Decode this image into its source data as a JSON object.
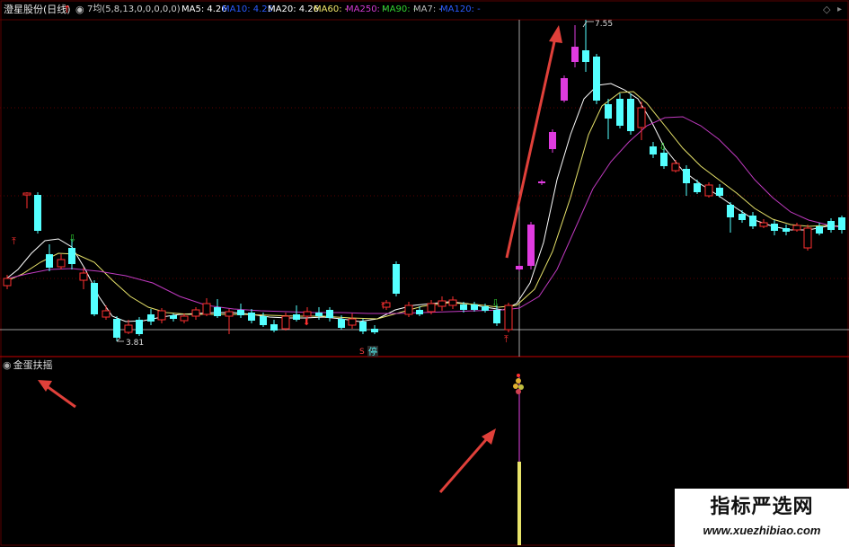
{
  "header": {
    "stock_name": "澄星股份(日线)",
    "up_arrow_icon": "↑",
    "settings_icon": "◉",
    "ma_config": "7均(5,8,13,0,0,0,0,0)",
    "ma_values": [
      {
        "label": "MA5: 4.26",
        "color": "#ffffff"
      },
      {
        "label": "MA10: 4.25",
        "color": "#2a5bff"
      },
      {
        "label": "MA20: 4.26",
        "color": "#ffffff"
      },
      {
        "label": "MA60: -",
        "color": "#f2e86a"
      },
      {
        "label": "MA250: -",
        "color": "#d23ad2"
      },
      {
        "label": "MA90: -",
        "color": "#31d431"
      },
      {
        "label": "MA7: -",
        "color": "#bbbbbb"
      },
      {
        "label": "MA120: -",
        "color": "#2a5bff"
      }
    ],
    "diamond_icon": "◇",
    "arrow_button": "▸"
  },
  "main_chart": {
    "high_label": "7.55",
    "low_label": "3.81",
    "stop_label": "停",
    "s_label": "S"
  },
  "sub_chart": {
    "title": "金蛋扶摇",
    "title_icon": "◉"
  },
  "watermark": {
    "text": "指标严选网",
    "url": "www.xuezhibiao.com"
  },
  "colors": {
    "up_candle": "#ff3030",
    "down_candle": "#54ffff",
    "grid": "#5a0000",
    "ma_white": "#ffffff",
    "ma_yellow": "#e8e36a",
    "ma_purple": "#c03ac0",
    "annotation_arrow": "#e0403a"
  }
}
